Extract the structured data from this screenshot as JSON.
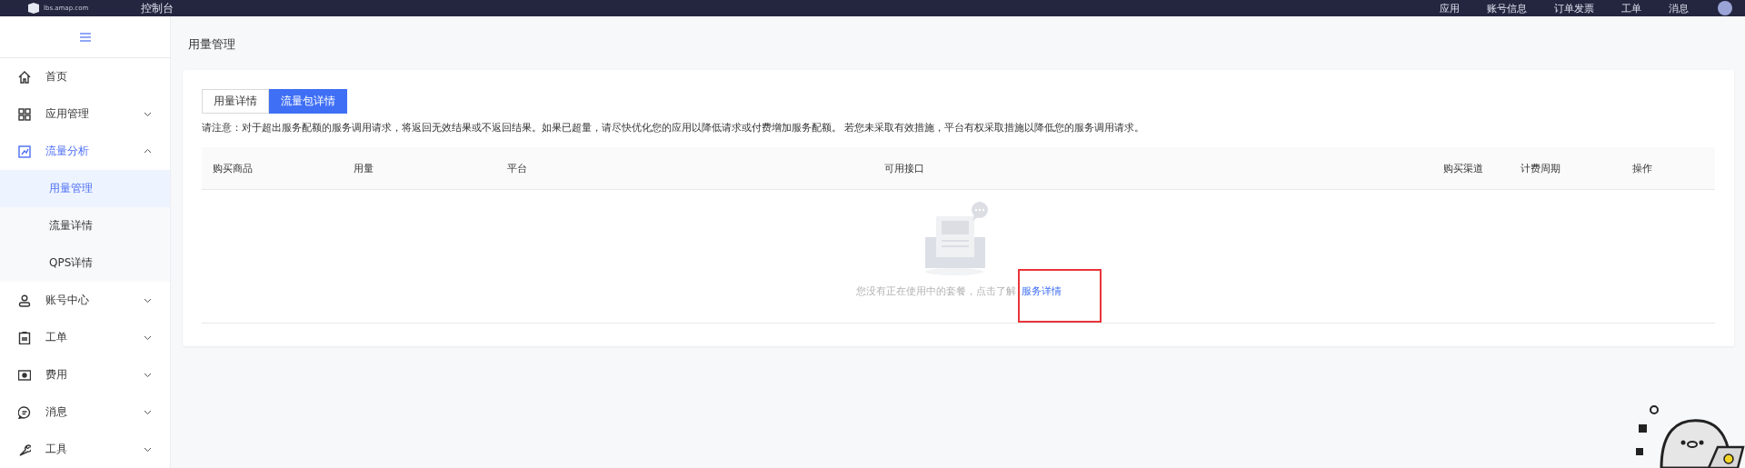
{
  "header": {
    "logo_subtitle": "lbs.amap.com",
    "title": "控制台",
    "nav": [
      "应用",
      "账号信息",
      "订单发票",
      "工单",
      "消息"
    ]
  },
  "sidebar": {
    "items": [
      {
        "label": "首页",
        "kind": "home",
        "expandable": false,
        "expanded": false
      },
      {
        "label": "应用管理",
        "kind": "grid",
        "expandable": true,
        "expanded": false
      },
      {
        "label": "流量分析",
        "kind": "chart",
        "expandable": true,
        "expanded": true,
        "children": [
          {
            "label": "用量管理",
            "selected": true
          },
          {
            "label": "流量详情",
            "selected": false
          },
          {
            "label": "QPS详情",
            "selected": false
          }
        ]
      },
      {
        "label": "账号中心",
        "kind": "user",
        "expandable": true,
        "expanded": false
      },
      {
        "label": "工单",
        "kind": "clipboard",
        "expandable": true,
        "expanded": false
      },
      {
        "label": "费用",
        "kind": "bill",
        "expandable": true,
        "expanded": false
      },
      {
        "label": "消息",
        "kind": "message",
        "expandable": true,
        "expanded": false
      },
      {
        "label": "工具",
        "kind": "wrench",
        "expandable": true,
        "expanded": false
      }
    ]
  },
  "page_title": "用量管理",
  "tabs": [
    {
      "label": "用量详情",
      "selected": false
    },
    {
      "label": "流量包详情",
      "selected": true
    }
  ],
  "notice": "请注意：对于超出服务配额的服务调用请求，将返回无效结果或不返回结果。如果已超量，请尽快优化您的应用以降低请求或付费增加服务配额。 若您未采取有效措施，平台有权采取措施以降低您的服务调用请求。",
  "table": {
    "columns": [
      "购买商品",
      "用量",
      "平台",
      "可用接口",
      "购买渠道",
      "计费周期",
      "操作"
    ]
  },
  "empty_state": {
    "message": "您没有正在使用中的套餐，点击了解",
    "link": "服务详情"
  }
}
